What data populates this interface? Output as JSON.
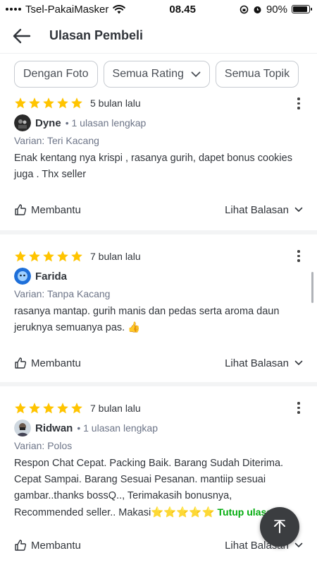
{
  "status_bar": {
    "carrier": "Tsel-PakaiMasker",
    "time": "08.45",
    "battery": "90%"
  },
  "header": {
    "title": "Ulasan Pembeli"
  },
  "filters": {
    "photo": "Dengan Foto",
    "rating": "Semua Rating",
    "topic": "Semua Topik"
  },
  "reviews": [
    {
      "rating": 5,
      "time": "5 bulan lalu",
      "user": "Dyne",
      "count": "• 1 ulasan lengkap",
      "variant": "Varian: Teri Kacang",
      "text": "Enak kentang nya krispi , rasanya gurih, dapet bonus cookies juga . Thx seller",
      "helpful": "Membantu",
      "reply": "Lihat Balasan"
    },
    {
      "rating": 5,
      "time": "7 bulan lalu",
      "user": "Farida",
      "count": "",
      "variant": "Varian: Tanpa Kacang",
      "text": "rasanya mantap. gurih manis dan pedas serta aroma daun jeruknya semuanya pas. 👍",
      "helpful": "Membantu",
      "reply": "Lihat Balasan"
    },
    {
      "rating": 5,
      "time": "7 bulan lalu",
      "user": "Ridwan",
      "count": "• 1 ulasan lengkap",
      "variant": "Varian: Polos",
      "text": "Respon Chat Cepat. Packing Baik. Barang Sudah Diterima. Cepat Sampai. Barang Sesuai Pesanan. mantiip sesuai gambar..thanks bossQ.., Terimakasih bonusnya, Recommended seller.. Makasi⭐⭐⭐⭐⭐",
      "collapse": "Tutup ulasan",
      "helpful": "Membantu",
      "reply": "Lihat Balasan"
    }
  ],
  "colors": {
    "star": "#ffc400",
    "accent_green": "#03ac0e",
    "fab": "#3b3d40"
  }
}
